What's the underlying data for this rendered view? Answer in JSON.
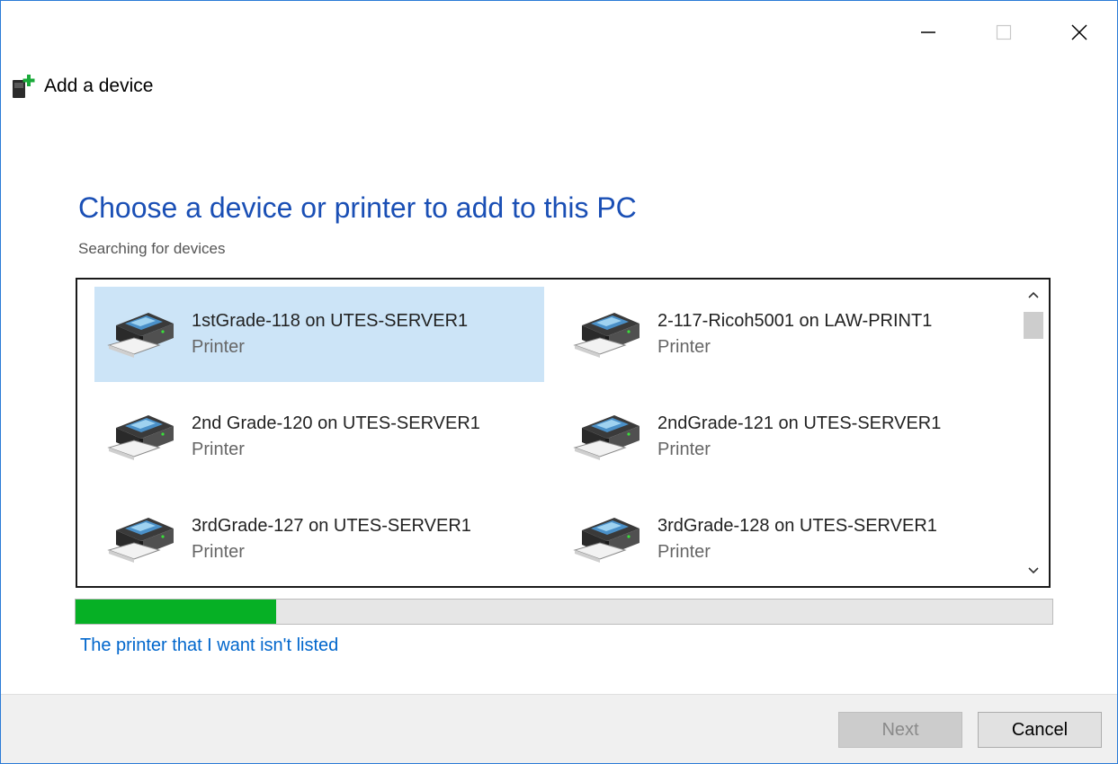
{
  "window": {
    "title": "Add a device",
    "controls": [
      "minimize-icon",
      "maximize-icon",
      "close-icon"
    ]
  },
  "main": {
    "heading": "Choose a device or printer to add to this PC",
    "status": "Searching for devices"
  },
  "devices": [
    {
      "name": "1stGrade-118 on UTES-SERVER1",
      "type": "Printer",
      "selected": true
    },
    {
      "name": "2-117-Ricoh5001 on LAW-PRINT1",
      "type": "Printer",
      "selected": false
    },
    {
      "name": "2nd Grade-120 on UTES-SERVER1",
      "type": "Printer",
      "selected": false
    },
    {
      "name": "2ndGrade-121 on UTES-SERVER1",
      "type": "Printer",
      "selected": false
    },
    {
      "name": "3rdGrade-127 on UTES-SERVER1",
      "type": "Printer",
      "selected": false
    },
    {
      "name": "3rdGrade-128 on UTES-SERVER1",
      "type": "Printer",
      "selected": false
    }
  ],
  "progress": {
    "fraction": 0.205,
    "color": "#06b025"
  },
  "link": {
    "label": "The printer that I want isn't listed"
  },
  "footer": {
    "next_label": "Next",
    "cancel_label": "Cancel",
    "next_enabled": false
  },
  "colors": {
    "heading": "#1a4fb5",
    "link": "#0066cc",
    "selection": "#cce4f7",
    "accent_border": "#2b7bd6"
  }
}
